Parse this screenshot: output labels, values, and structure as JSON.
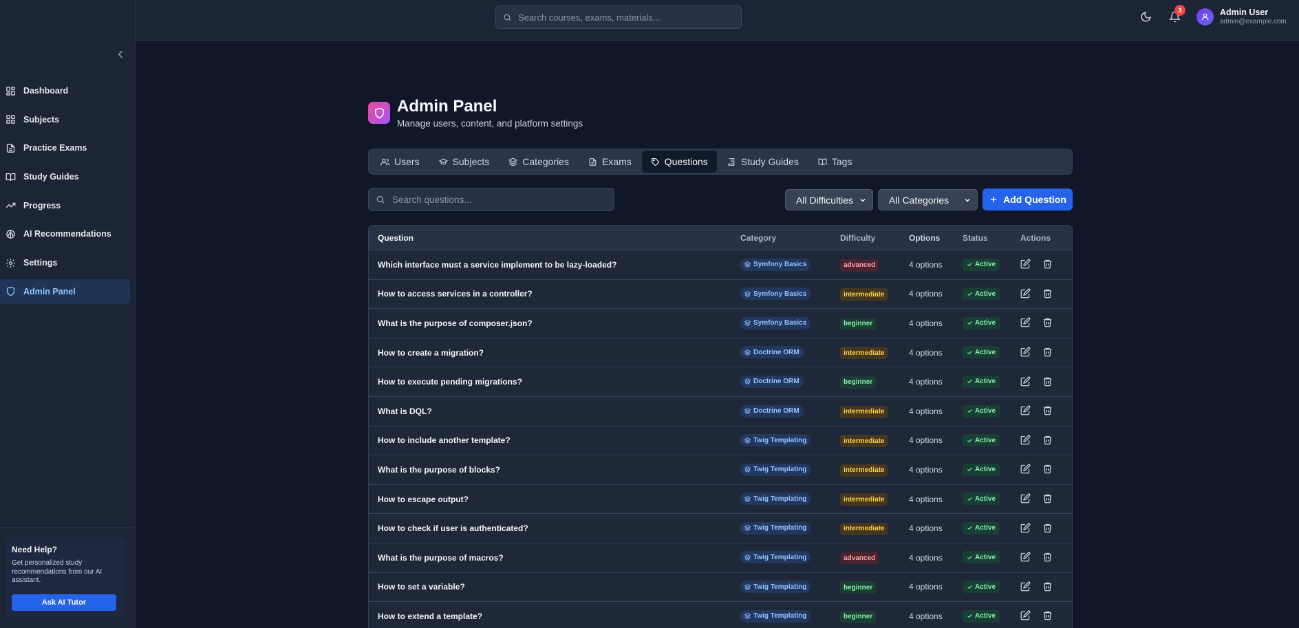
{
  "topbar": {
    "search_placeholder": "Search courses, exams, materials...",
    "notification_count": "3",
    "user_name": "Admin User",
    "user_email": "admin@example.com"
  },
  "sidebar": {
    "items": [
      {
        "label": "Dashboard",
        "icon": "grid-icon"
      },
      {
        "label": "Subjects",
        "icon": "grid-icon"
      },
      {
        "label": "Practice Exams",
        "icon": "document-icon"
      },
      {
        "label": "Study Guides",
        "icon": "book-open-icon"
      },
      {
        "label": "Progress",
        "icon": "trending-up-icon"
      },
      {
        "label": "AI Recommendations",
        "icon": "brain-icon"
      },
      {
        "label": "Settings",
        "icon": "gear-icon"
      },
      {
        "label": "Admin Panel",
        "icon": "shield-icon"
      }
    ],
    "active_item": "Admin Panel",
    "help": {
      "title": "Need Help?",
      "text": "Get personalized study recommendations from our AI assistant.",
      "button": "Ask AI Tutor"
    }
  },
  "page": {
    "title": "Admin Panel",
    "subtitle": "Manage users, content, and platform settings"
  },
  "tabs": [
    {
      "label": "Users",
      "icon": "users-icon"
    },
    {
      "label": "Subjects",
      "icon": "graduation-cap-icon"
    },
    {
      "label": "Categories",
      "icon": "layers-icon"
    },
    {
      "label": "Exams",
      "icon": "document-icon"
    },
    {
      "label": "Questions",
      "icon": "tag-icon"
    },
    {
      "label": "Study Guides",
      "icon": "book-icon"
    },
    {
      "label": "Tags",
      "icon": "book-open-icon"
    }
  ],
  "active_tab": "Questions",
  "toolbar": {
    "search_placeholder": "Search questions...",
    "difficulty_filter": "All Difficulties",
    "category_filter": "All Categories",
    "add_button": "Add Question"
  },
  "table": {
    "columns": [
      "Question",
      "Category",
      "Difficulty",
      "Options",
      "Status",
      "Actions"
    ],
    "rows": [
      {
        "question": "Which interface must a service implement to be lazy-loaded?",
        "category": "Symfony Basics",
        "difficulty": "advanced",
        "options": "4 options",
        "status": "Active"
      },
      {
        "question": "How to access services in a controller?",
        "category": "Symfony Basics",
        "difficulty": "intermediate",
        "options": "4 options",
        "status": "Active"
      },
      {
        "question": "What is the purpose of composer.json?",
        "category": "Symfony Basics",
        "difficulty": "beginner",
        "options": "4 options",
        "status": "Active"
      },
      {
        "question": "How to create a migration?",
        "category": "Doctrine ORM",
        "difficulty": "intermediate",
        "options": "4 options",
        "status": "Active"
      },
      {
        "question": "How to execute pending migrations?",
        "category": "Doctrine ORM",
        "difficulty": "beginner",
        "options": "4 options",
        "status": "Active"
      },
      {
        "question": "What is DQL?",
        "category": "Doctrine ORM",
        "difficulty": "intermediate",
        "options": "4 options",
        "status": "Active"
      },
      {
        "question": "How to include another template?",
        "category": "Twig Templating",
        "difficulty": "intermediate",
        "options": "4 options",
        "status": "Active"
      },
      {
        "question": "What is the purpose of blocks?",
        "category": "Twig Templating",
        "difficulty": "intermediate",
        "options": "4 options",
        "status": "Active"
      },
      {
        "question": "How to escape output?",
        "category": "Twig Templating",
        "difficulty": "intermediate",
        "options": "4 options",
        "status": "Active"
      },
      {
        "question": "How to check if user is authenticated?",
        "category": "Twig Templating",
        "difficulty": "intermediate",
        "options": "4 options",
        "status": "Active"
      },
      {
        "question": "What is the purpose of macros?",
        "category": "Twig Templating",
        "difficulty": "advanced",
        "options": "4 options",
        "status": "Active"
      },
      {
        "question": "How to set a variable?",
        "category": "Twig Templating",
        "difficulty": "beginner",
        "options": "4 options",
        "status": "Active"
      },
      {
        "question": "How to extend a template?",
        "category": "Twig Templating",
        "difficulty": "beginner",
        "options": "4 options",
        "status": "Active"
      }
    ]
  },
  "colors": {
    "accent": "#2563eb",
    "background": "#0f1729",
    "surface": "#1b2536"
  }
}
